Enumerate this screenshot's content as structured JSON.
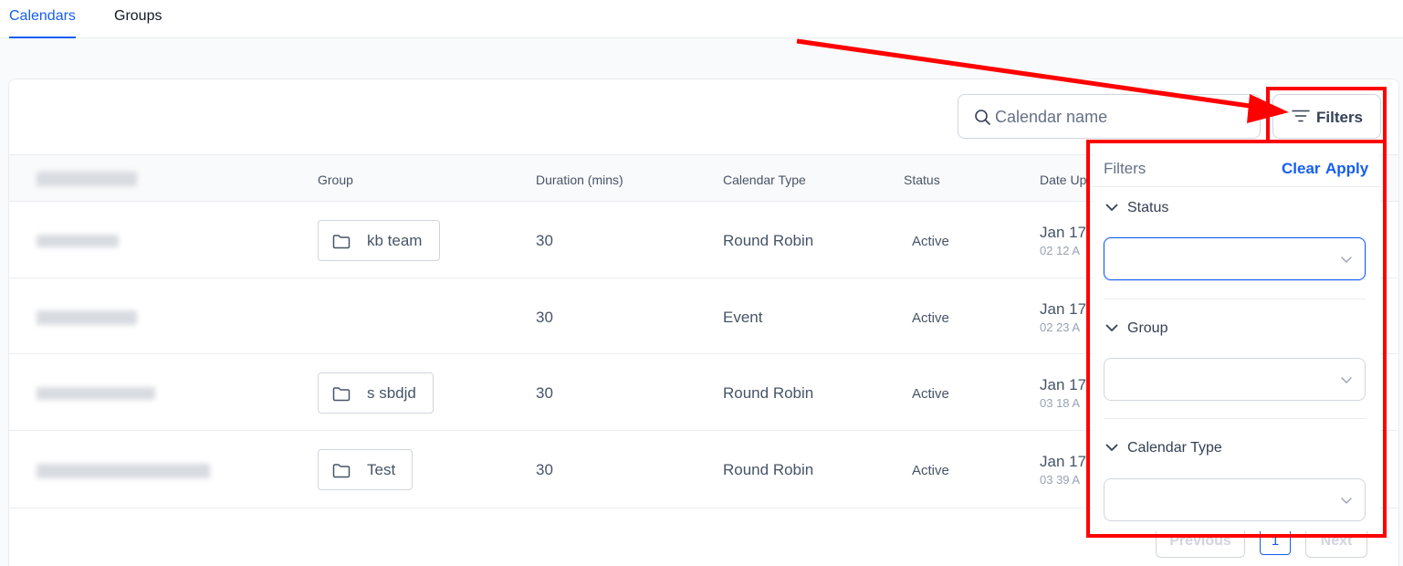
{
  "tabs": [
    {
      "label": "Calendars",
      "active": true
    },
    {
      "label": "Groups",
      "active": false
    }
  ],
  "toolbar": {
    "search_placeholder": "Calendar name",
    "filters_label": "Filters"
  },
  "table": {
    "columns": [
      "",
      "Group",
      "Duration (mins)",
      "Calendar Type",
      "Status",
      "Date Up"
    ],
    "rows": [
      {
        "group": "kb team",
        "duration": "30",
        "type": "Round Robin",
        "status": "Active",
        "date": "Jan 17",
        "time": "02 12 A"
      },
      {
        "group": "",
        "duration": "30",
        "type": "Event",
        "status": "Active",
        "date": "Jan 17",
        "time": "02 23 A"
      },
      {
        "group": "s sbdjd",
        "duration": "30",
        "type": "Round Robin",
        "status": "Active",
        "date": "Jan 17",
        "time": "03 18 A"
      },
      {
        "group": "Test",
        "duration": "30",
        "type": "Round Robin",
        "status": "Active",
        "date": "Jan 17",
        "time": "03 39 A"
      }
    ]
  },
  "pagination": {
    "previous_label": "Previous",
    "page": "1",
    "next_label": "Next"
  },
  "filter_panel": {
    "title": "Filters",
    "clear_label": "Clear",
    "apply_label": "Apply",
    "sections": [
      {
        "label": "Status"
      },
      {
        "label": "Group"
      },
      {
        "label": "Calendar Type"
      }
    ]
  },
  "colors": {
    "accent": "#155eef",
    "annotation": "#ff0000"
  }
}
